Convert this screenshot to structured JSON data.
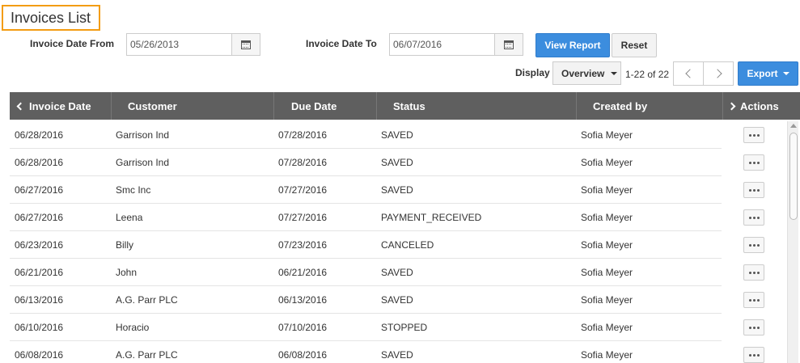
{
  "page": {
    "title": "Invoices List"
  },
  "filters": {
    "from_label": "Invoice Date From",
    "from_value": "05/26/2013",
    "to_label": "Invoice Date To",
    "to_value": "06/07/2016",
    "view_report_label": "View Report",
    "reset_label": "Reset"
  },
  "toolbar": {
    "display_label": "Display",
    "display_selected": "Overview",
    "pager_text": "1-22 of 22",
    "export_label": "Export"
  },
  "table": {
    "headers": {
      "invoice_date": "Invoice Date",
      "customer": "Customer",
      "due_date": "Due Date",
      "status": "Status",
      "created_by": "Created by",
      "actions": "Actions"
    },
    "rows": [
      {
        "invoice_date": "06/28/2016",
        "customer": "Garrison Ind",
        "due_date": "07/28/2016",
        "status": "SAVED",
        "created_by": "Sofia Meyer"
      },
      {
        "invoice_date": "06/28/2016",
        "customer": "Garrison Ind",
        "due_date": "07/28/2016",
        "status": "SAVED",
        "created_by": "Sofia Meyer"
      },
      {
        "invoice_date": "06/27/2016",
        "customer": "Smc Inc",
        "due_date": "07/27/2016",
        "status": "SAVED",
        "created_by": "Sofia Meyer"
      },
      {
        "invoice_date": "06/27/2016",
        "customer": "Leena",
        "due_date": "07/27/2016",
        "status": "PAYMENT_RECEIVED",
        "created_by": "Sofia Meyer"
      },
      {
        "invoice_date": "06/23/2016",
        "customer": "Billy",
        "due_date": "07/23/2016",
        "status": "CANCELED",
        "created_by": "Sofia Meyer"
      },
      {
        "invoice_date": "06/21/2016",
        "customer": "John",
        "due_date": "06/21/2016",
        "status": "SAVED",
        "created_by": "Sofia Meyer"
      },
      {
        "invoice_date": "06/13/2016",
        "customer": "A.G. Parr PLC",
        "due_date": "06/13/2016",
        "status": "SAVED",
        "created_by": "Sofia Meyer"
      },
      {
        "invoice_date": "06/10/2016",
        "customer": "Horacio",
        "due_date": "07/10/2016",
        "status": "STOPPED",
        "created_by": "Sofia Meyer"
      },
      {
        "invoice_date": "06/08/2016",
        "customer": "A.G. Parr PLC",
        "due_date": "06/08/2016",
        "status": "SAVED",
        "created_by": "Sofia Meyer"
      }
    ]
  },
  "icons": {
    "calendar": "calendar-icon",
    "prev": "chevron-left-icon",
    "next": "chevron-right-icon",
    "more": "more-horizontal-icon"
  },
  "colors": {
    "title_border": "#f39c12",
    "primary": "#3c8dde",
    "header_bg": "#5f5f5f"
  }
}
